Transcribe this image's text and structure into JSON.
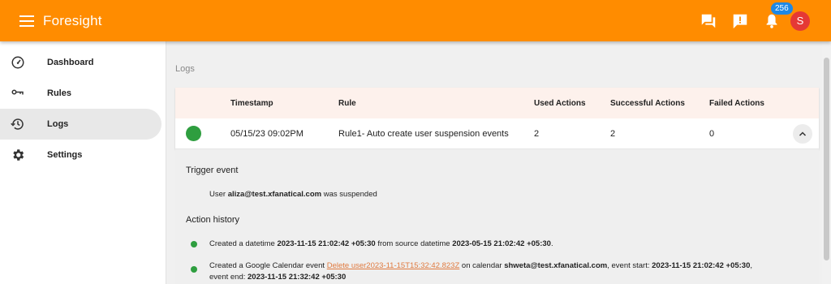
{
  "app": {
    "title": "Foresight"
  },
  "header": {
    "notification_count": "256",
    "avatar_initial": "S"
  },
  "sidebar": {
    "items": [
      {
        "label": "Dashboard",
        "icon": "dashboard-icon"
      },
      {
        "label": "Rules",
        "icon": "key-icon"
      },
      {
        "label": "Logs",
        "icon": "history-icon",
        "active": true
      },
      {
        "label": "Settings",
        "icon": "gear-icon"
      }
    ]
  },
  "breadcrumb": "Logs",
  "table": {
    "columns": [
      "Timestamp",
      "Rule",
      "Used Actions",
      "Successful Actions",
      "Failed Actions"
    ],
    "rows": [
      {
        "timestamp": "05/15/23 09:02PM",
        "rule": "Rule1- Auto create user suspension events",
        "used": "2",
        "successful": "2",
        "failed": "0",
        "status_color": "#2e9e3f"
      }
    ]
  },
  "detail": {
    "trigger_title": "Trigger event",
    "trigger": {
      "prefix": "User",
      "email": "aliza@test.xfanatical.com",
      "suffix": "was suspended"
    },
    "history_title": "Action history",
    "actions": [
      {
        "a": "Created a datetime",
        "b": "2023-11-15 21:02:42 +05:30",
        "c": "from source datetime",
        "d": "2023-05-15 21:02:42 +05:30",
        "e": "."
      },
      {
        "a": "Created a Google Calendar event",
        "link": "Delete user2023-11-15T15:32:42.823Z",
        "c": "on calendar",
        "calendar": "shweta@test.xfanatical.com",
        "e": ", event start:",
        "start": "2023-11-15 21:02:42 +05:30",
        "f": ",",
        "g": "event end:",
        "end": "2023-11-15 21:32:42 +05:30"
      }
    ]
  },
  "colors": {
    "accent": "#ff8c00",
    "success": "#2e9e3f",
    "badge": "#1e88e5",
    "avatar": "#e53935",
    "link": "#e07a3f"
  }
}
